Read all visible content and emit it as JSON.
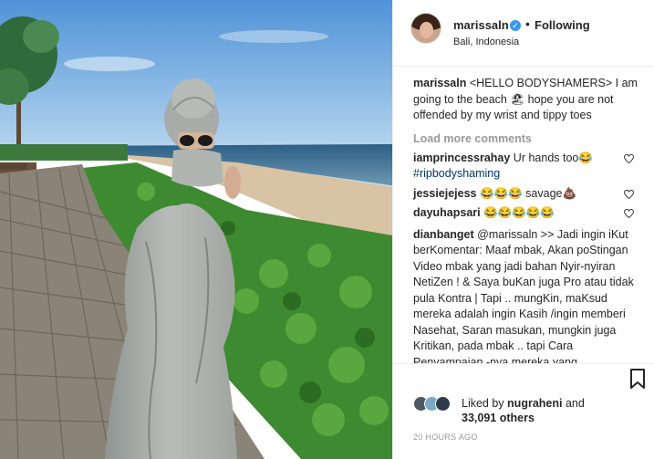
{
  "post": {
    "username": "marissaln",
    "verified_icon": "verified-badge-icon",
    "separator": "•",
    "follow_status": "Following",
    "location": "Bali, Indonesia"
  },
  "caption": {
    "author": "marissaln",
    "text": "<HELLO BODYSHAMERS> I am going to the beach 🏖 hope you are not offended by my wrist and tippy toes"
  },
  "load_more": "Load more comments",
  "comments": [
    {
      "author": "iamprincessrahay",
      "text": "Ur hands too😂",
      "hashtag": "#ripbodyshaming"
    },
    {
      "author": "jessiejejess",
      "text": "😂😂😂 savage💩"
    },
    {
      "author": "dayuhapsari",
      "text": "😂😂😂😂😂"
    },
    {
      "author": "dianbanget",
      "text": "@marissaln >> Jadi ingin iKut berKomentar: Maaf mbak, Akan poStingan Video mbak yang jadi bahan Nyir-nyiran NetiZen ! & Saya buKan juga Pro atau tidak pula Kontra | Tapi .. mungKin, maKsud mereka adalah ingin Kasih /ingin memberi Nasehat, Saran masukan, mungkin juga Kritikan, pada mbak .. tapi Cara Penyampaian -nya mereka yang"
    }
  ],
  "likes": {
    "prefix": "Liked by",
    "first_user": "nugraheni",
    "joiner": "and",
    "count": "33,091 others"
  },
  "timestamp": "20 HOURS AGO",
  "icons": {
    "heart": "heart-icon",
    "bookmark": "bookmark-icon"
  }
}
